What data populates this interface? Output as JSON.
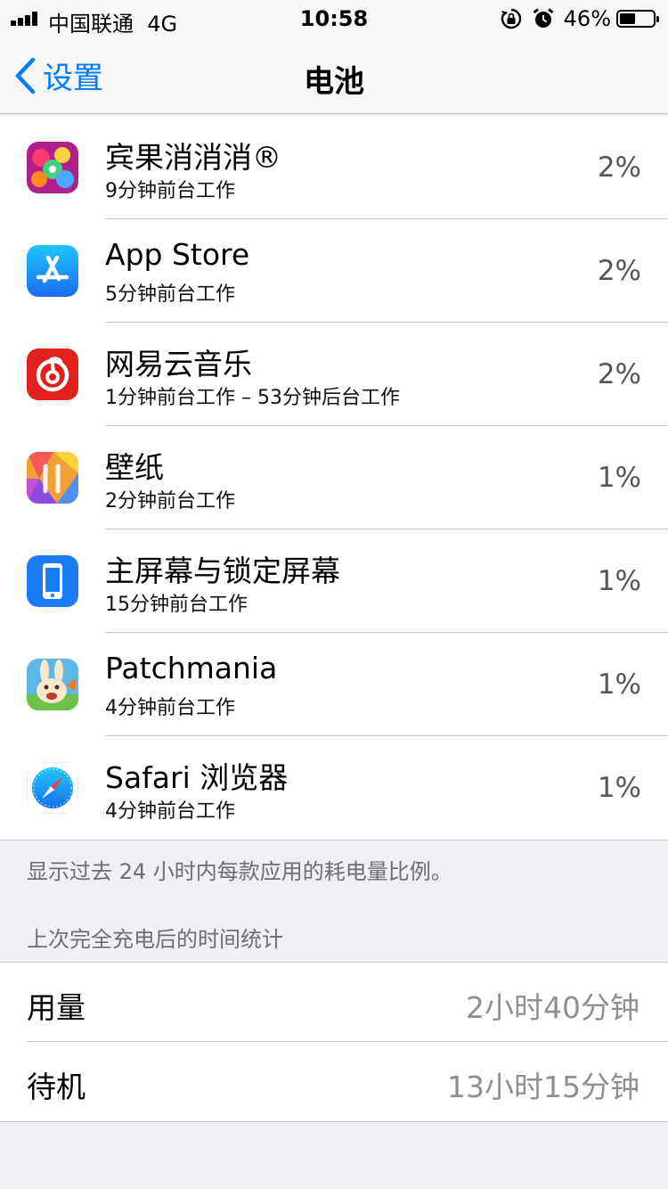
{
  "status_bar": {
    "carrier": "中国联通",
    "network": "4G",
    "time": "10:58",
    "battery_percent_label": "46%",
    "battery_level": 0.46
  },
  "nav": {
    "back_label": "设置",
    "title": "电池"
  },
  "apps": [
    {
      "name": "宾果消消消®",
      "detail": "9分钟前台工作",
      "percent": "2%"
    },
    {
      "name": "App Store",
      "detail": "5分钟前台工作",
      "percent": "2%"
    },
    {
      "name": "网易云音乐",
      "detail": "1分钟前台工作 – 53分钟后台工作",
      "percent": "2%"
    },
    {
      "name": "壁纸",
      "detail": "2分钟前台工作",
      "percent": "1%"
    },
    {
      "name": "主屏幕与锁定屏幕",
      "detail": "15分钟前台工作",
      "percent": "1%"
    },
    {
      "name": "Patchmania",
      "detail": "4分钟前台工作",
      "percent": "1%"
    },
    {
      "name": "Safari 浏览器",
      "detail": "4分钟前台工作",
      "percent": "1%"
    }
  ],
  "footer_note": "显示过去 24 小时内每款应用的耗电量比例。",
  "section_header": "上次完全充电后的时间统计",
  "stats": [
    {
      "label": "用量",
      "value": "2小时40分钟"
    },
    {
      "label": "待机",
      "value": "13小时15分钟"
    }
  ],
  "colors": {
    "accent": "#007aff",
    "background": "#efeff4",
    "separator": "#c8c7cc",
    "secondary_text": "#8e8e93"
  }
}
